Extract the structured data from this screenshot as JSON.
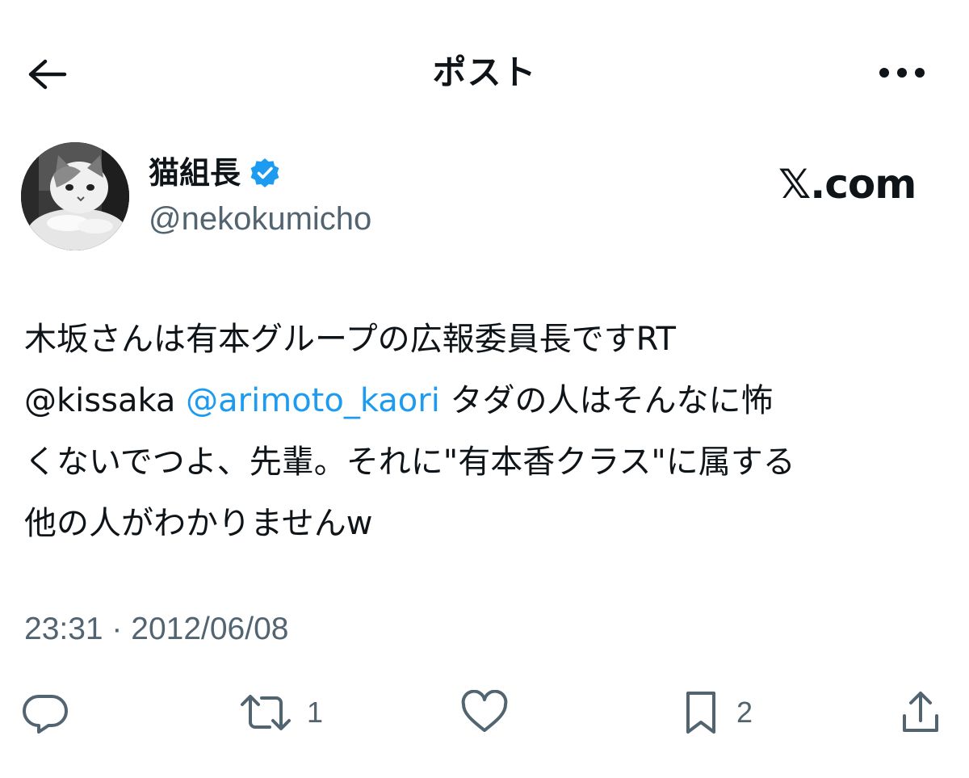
{
  "header": {
    "title": "ポスト",
    "back_icon": "arrow-left-icon",
    "more_icon": "more-horizontal-icon"
  },
  "author": {
    "display_name": "猫組長",
    "handle": "@nekokumicho",
    "verified": true,
    "verified_color": "#1d9bf0"
  },
  "source": "𝕏.com",
  "post": {
    "lines": [
      [
        {
          "text": "木坂さんは有本グループの広報委員長ですRT"
        }
      ],
      [
        {
          "text": "@kissaka "
        },
        {
          "text": "@arimoto_kaori",
          "link": true
        },
        {
          "text": " タダの人はそんなに怖"
        }
      ],
      [
        {
          "text": "くないでつよ、先輩。それに\"有本香クラス\"に属する"
        }
      ],
      [
        {
          "text": "他の人がわかりませんw"
        }
      ]
    ]
  },
  "timestamp": "23:31 · 2012/06/08",
  "actions": {
    "reply": {
      "icon": "reply-icon",
      "count": ""
    },
    "retweet": {
      "icon": "retweet-icon",
      "count": "1"
    },
    "like": {
      "icon": "heart-icon",
      "count": ""
    },
    "bookmark": {
      "icon": "bookmark-icon",
      "count": "2"
    },
    "share": {
      "icon": "share-icon",
      "count": ""
    }
  },
  "colors": {
    "text": "#0f1419",
    "secondary": "#536471",
    "link": "#1d9bf0",
    "background": "#ffffff"
  }
}
